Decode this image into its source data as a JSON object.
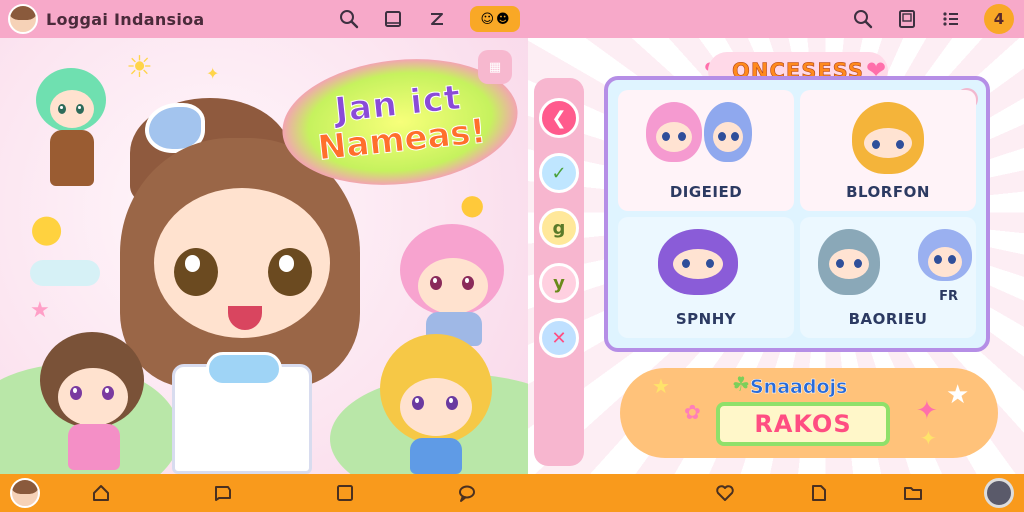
{
  "header_left": {
    "title": "Loggai Indansioa"
  },
  "scene": {
    "speech_line1": "Jan ict",
    "speech_line2": "Nameas!"
  },
  "panel": {
    "title": "ONCESESS",
    "cards": [
      {
        "label": "DIGEIED"
      },
      {
        "label": "BLORFON"
      },
      {
        "label": "SPNHY"
      },
      {
        "label": "BAORIEU"
      }
    ],
    "extra_label": "FR",
    "reward_title": "Snaadojs",
    "reward_button": "RAKOS"
  },
  "side_buttons": [
    "back",
    "check",
    "g",
    "y",
    "x"
  ],
  "colors": {
    "top_bar": "#f7a9c9",
    "bottom_bar": "#f99a1c",
    "accent_orange": "#f9a826",
    "accent_pink": "#ff6fab"
  }
}
